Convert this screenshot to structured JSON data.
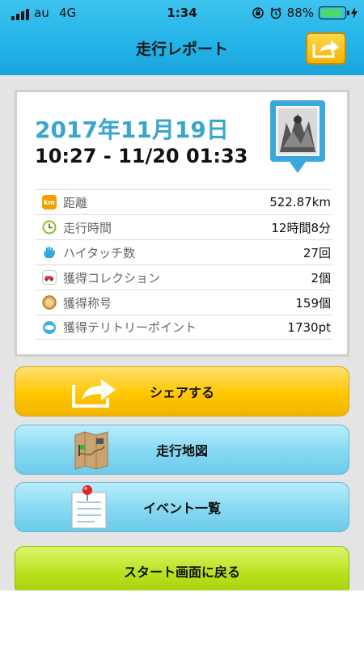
{
  "status": {
    "carrier": "au",
    "network": "4G",
    "time": "1:34",
    "battery": "88%",
    "battery_level": 0.88
  },
  "nav": {
    "title": "走行レポート",
    "share_icon": "share-arrow-icon"
  },
  "report": {
    "date": "2017年11月19日",
    "time_range": "10:27 - 11/20 01:33",
    "rows": [
      {
        "icon": "km-icon",
        "label": "距離",
        "value": "522.87km",
        "color": "#f0a000"
      },
      {
        "icon": "clock-icon",
        "label": "走行時間",
        "value": "12時間8分",
        "color": "#8cbf2a"
      },
      {
        "icon": "hand-icon",
        "label": "ハイタッチ数",
        "value": "27回",
        "color": "#2fa8e0"
      },
      {
        "icon": "car-icon",
        "label": "獲得コレクション",
        "value": "2個",
        "color": "#e03a3a"
      },
      {
        "icon": "medal-icon",
        "label": "獲得称号",
        "value": "159個",
        "color": "#d9a040"
      },
      {
        "icon": "spot-icon",
        "label": "獲得テリトリーポイント",
        "value": "1730pt",
        "color": "#3bb0e0"
      }
    ]
  },
  "buttons": {
    "share": "シェアする",
    "map": "走行地図",
    "events": "イベント一覧",
    "back": "スタート画面に戻る"
  }
}
